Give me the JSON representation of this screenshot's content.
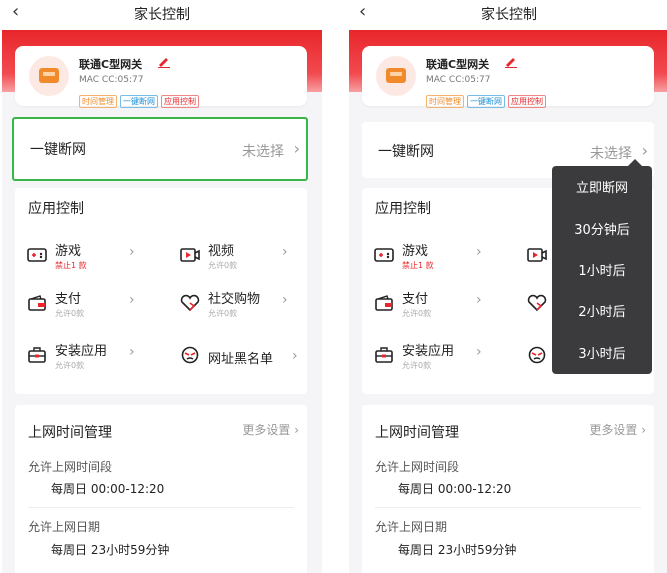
{
  "nav": {
    "back_glyph": "‹",
    "title": "家长控制"
  },
  "device": {
    "name": "联通C型网关",
    "mac": "MAC CC:05:77",
    "tags": [
      "时间管理",
      "一键断网",
      "应用控制"
    ],
    "avatar_icon": "router-icon",
    "edit_icon": "pencil-icon"
  },
  "one_key_cut": {
    "label": "一键断网",
    "value": "未选择",
    "chevron": "›"
  },
  "app_control": {
    "title": "应用控制",
    "items": [
      {
        "name": "游戏",
        "sub": "禁止1 款",
        "icon": "game-icon"
      },
      {
        "name": "视频",
        "sub": "允许0款",
        "icon": "video-icon"
      },
      {
        "name": "支付",
        "sub": "允许0款",
        "icon": "wallet-icon"
      },
      {
        "name": "社交购物",
        "sub": "允许0款",
        "icon": "heart-icon"
      },
      {
        "name": "安装应用",
        "sub": "允许0款",
        "icon": "toolbox-icon"
      },
      {
        "name": "网址黑名单",
        "sub": "",
        "icon": "mask-icon"
      }
    ],
    "chevron": "›"
  },
  "time_mgmt": {
    "title": "上网时间管理",
    "more": "更多设置",
    "period_label": "允许上网时间段",
    "period_value": "每周日 00:00-12:20",
    "date_label": "允许上网日期",
    "date_value": "每周日 23小时59分钟"
  },
  "popup": {
    "options": [
      "立即断网",
      "30分钟后",
      "1小时后",
      "2小时后",
      "3小时后"
    ]
  },
  "colors": {
    "brand_red": "#e8262b",
    "highlight_green": "#3ab54a",
    "popup_bg": "#3b3b3d"
  }
}
